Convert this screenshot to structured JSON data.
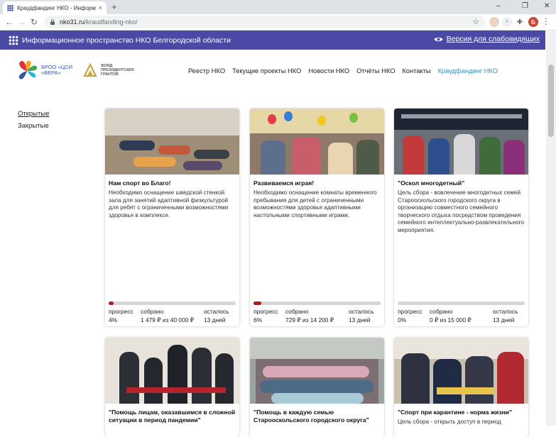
{
  "browser": {
    "tab_title": "Краудфандинг НКО - Информа...",
    "tab_close": "×",
    "new_tab": "+",
    "url_host": "nko31.ru",
    "url_path": "/kraudfanding-nko/",
    "profile_initial": "Б",
    "minimize": "–",
    "maximize": "❐",
    "close": "✕",
    "back": "←",
    "forward": "→",
    "reload": "↻",
    "star": "☆",
    "menu": "⋮"
  },
  "topstrip": {
    "site_name": "Информационное пространство НКО Белгородской области",
    "low_vision": "Версия для слабовидящих"
  },
  "logos": {
    "vera_text": "БРОО «ЦСИ «ВЕРА»",
    "fpg_text": "ФОНД ПРЕЗИДЕНТСКИХ ГРАНТОВ"
  },
  "nav": [
    {
      "label": "Реестр НКО",
      "active": false
    },
    {
      "label": "Текущие проекты НКО",
      "active": false
    },
    {
      "label": "Новости НКО",
      "active": false
    },
    {
      "label": "Отчёты НКО",
      "active": false
    },
    {
      "label": "Контакты",
      "active": false
    },
    {
      "label": "Краудфандинг НКО",
      "active": true
    }
  ],
  "sidebar": {
    "open": "Открытые",
    "closed": "Закрытые"
  },
  "labels": {
    "progress": "прогресс",
    "collected": "собрано",
    "remaining": "осталось"
  },
  "cards": [
    {
      "title": "Нам спорт во Благо!",
      "description": "Необходимо оснащение шведской стенкой зала для занятий адаптивной физкультурой для ребят с ограниченными возможностями здоровья в комплексе.",
      "progress_text": "4%",
      "progress": 0.04,
      "collected": "1 479 ₽ из 40 000 ₽",
      "remaining": "13 дней"
    },
    {
      "title": "Развиваемся играя!",
      "description": "Необходимо оснащение комнаты временного пребывания для детей с ограниченными возможностями здоровья адаптивными настольными спортивными играми.",
      "progress_text": "6%",
      "progress": 0.06,
      "collected": "729 ₽ из 14 200 ₽",
      "remaining": "13 дней"
    },
    {
      "title": "\"Оскол многодетный\"",
      "description": "Цель сбора - вовлечение многодетных семей Старооскольского городского округа в организацию совместного семейного творческого отдыха посредством проведения семейного интеллектуально-развлекательного мероприятия.",
      "progress_text": "0%",
      "progress": 0,
      "collected": "0 ₽ из 15 000 ₽",
      "remaining": "13 дней"
    },
    {
      "title": "\"Помощь лицам, оказавшимся в сложной ситуации в период пандемии\"",
      "description": ""
    },
    {
      "title": "\"Помощь в каждую семью Старооскольского городского округа\"",
      "description": ""
    },
    {
      "title": "\"Спорт при карантине - норма жизни\"",
      "description": "Цель сбора - открыть доступ в период"
    }
  ]
}
